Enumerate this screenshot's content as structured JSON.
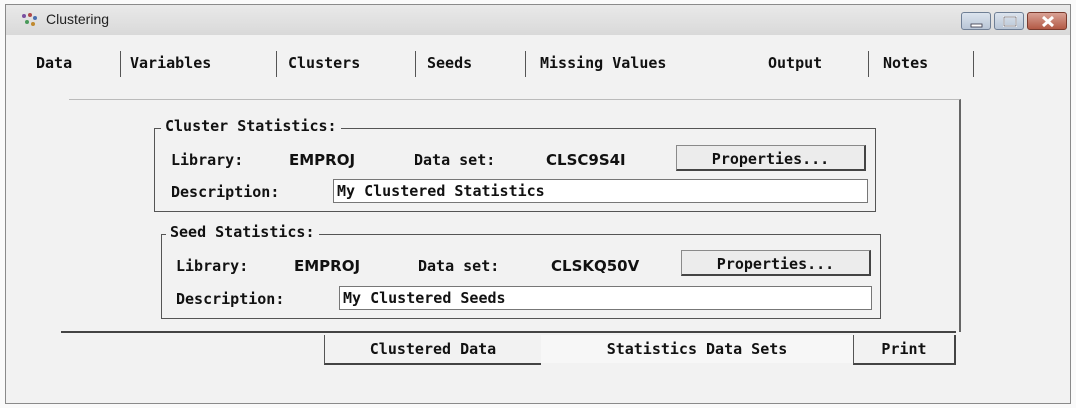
{
  "window": {
    "title": "Clustering",
    "icon": "cluster-app-icon",
    "controls": [
      "minimize-icon",
      "maximize-icon",
      "close-icon"
    ]
  },
  "tabs": [
    {
      "label": "Data"
    },
    {
      "label": "Variables"
    },
    {
      "label": "Clusters"
    },
    {
      "label": "Seeds"
    },
    {
      "label": "Missing Values"
    },
    {
      "label": "Output"
    },
    {
      "label": "Notes"
    }
  ],
  "cluster_statistics": {
    "legend": "Cluster Statistics:",
    "library_label": "Library:",
    "library_value": "EMPROJ",
    "dataset_label": "Data set:",
    "dataset_value": "CLSC9S4I",
    "properties_label": "Properties...",
    "description_label": "Description:",
    "description_value": "My Clustered Statistics"
  },
  "seed_statistics": {
    "legend": "Seed Statistics:",
    "library_label": "Library:",
    "library_value": "EMPROJ",
    "dataset_label": "Data set:",
    "dataset_value": "CLSKQ50V",
    "properties_label": "Properties...",
    "description_label": "Description:",
    "description_value": "My Clustered Seeds"
  },
  "bottom_tabs": [
    {
      "label": "Clustered Data"
    },
    {
      "label": "Statistics Data Sets"
    },
    {
      "label": "Print"
    }
  ],
  "active_tab": "Output",
  "active_bottom_tab": "Statistics Data Sets"
}
